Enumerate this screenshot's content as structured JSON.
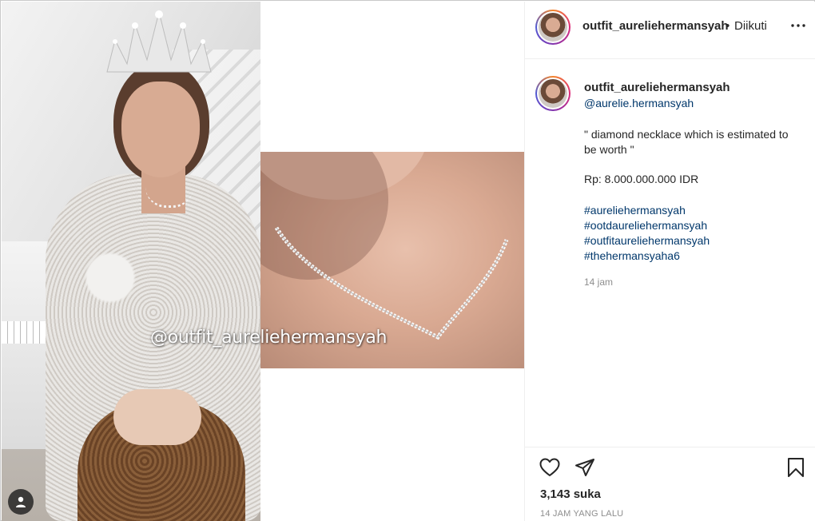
{
  "post": {
    "watermark": "@outfit_aureliehermansyah",
    "left_image_icon": "person-icon"
  },
  "header": {
    "username": "outfit_aureliehermansyah",
    "separator": "•",
    "follow_label": "Diikuti",
    "more_icon": "more-horizontal-icon"
  },
  "caption": {
    "username": "outfit_aureliehermansyah",
    "mention": "@aurelie.hermansyah",
    "quote": "\" diamond necklace which is estimated to be worth \"",
    "price": "Rp: 8.000.000.000 IDR",
    "hashtags": [
      "#aureliehermansyah",
      "#ootdaureliehermansyah",
      "#outfitaureliehermansyah",
      "#thehermansyaha6"
    ],
    "time": "14 jam"
  },
  "actions": {
    "like_icon": "heart-icon",
    "share_icon": "paper-plane-icon",
    "save_icon": "bookmark-icon",
    "likes_text": "3,143 suka",
    "time_ago": "14 JAM YANG LALU"
  },
  "colors": {
    "text": "#262626",
    "link": "#00376b",
    "muted": "#8e8e8e",
    "divider": "#efefef"
  }
}
